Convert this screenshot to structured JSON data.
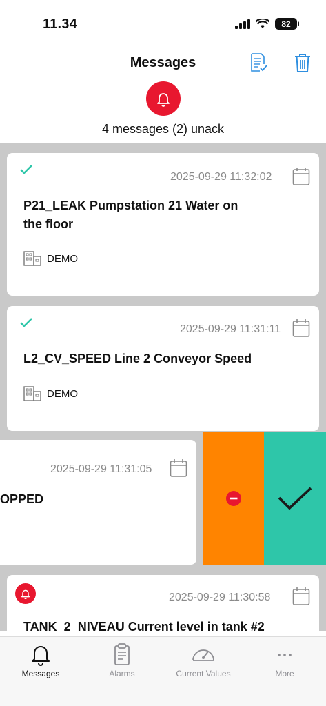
{
  "status_bar": {
    "time": "11.34",
    "battery": "82"
  },
  "header": {
    "title": "Messages",
    "summary": "4 messages (2) unack"
  },
  "messages": [
    {
      "timestamp": "2025-09-29 11:32:02",
      "title_line1": "P21_LEAK Pumpstation 21 Water on",
      "title_line2": "the floor",
      "site": "DEMO",
      "state": "acknowledged"
    },
    {
      "timestamp": "2025-09-29 11:31:11",
      "title_line1": "L2_CV_SPEED Line 2 Conveyor Speed",
      "site": "DEMO",
      "state": "acknowledged"
    },
    {
      "timestamp": "2025-09-29 11:31:05",
      "title_line1": "OPPED",
      "state": "swiped"
    },
    {
      "timestamp": "2025-09-29 11:30:58",
      "title_line1": "TANK_2_NIVEAU Current level in tank #2",
      "state": "unacknowledged"
    }
  ],
  "tabs": [
    {
      "label": "Messages",
      "icon": "bell-icon",
      "active": true
    },
    {
      "label": "Alarms",
      "icon": "clipboard-icon",
      "active": false
    },
    {
      "label": "Current Values",
      "icon": "gauge-icon",
      "active": false
    },
    {
      "label": "More",
      "icon": "ellipsis-icon",
      "active": false
    }
  ],
  "colors": {
    "accent_blue": "#2f8fe0",
    "alarm_red": "#e8172f",
    "ack_green": "#2ec6a9",
    "swipe_orange": "#ff8400"
  }
}
